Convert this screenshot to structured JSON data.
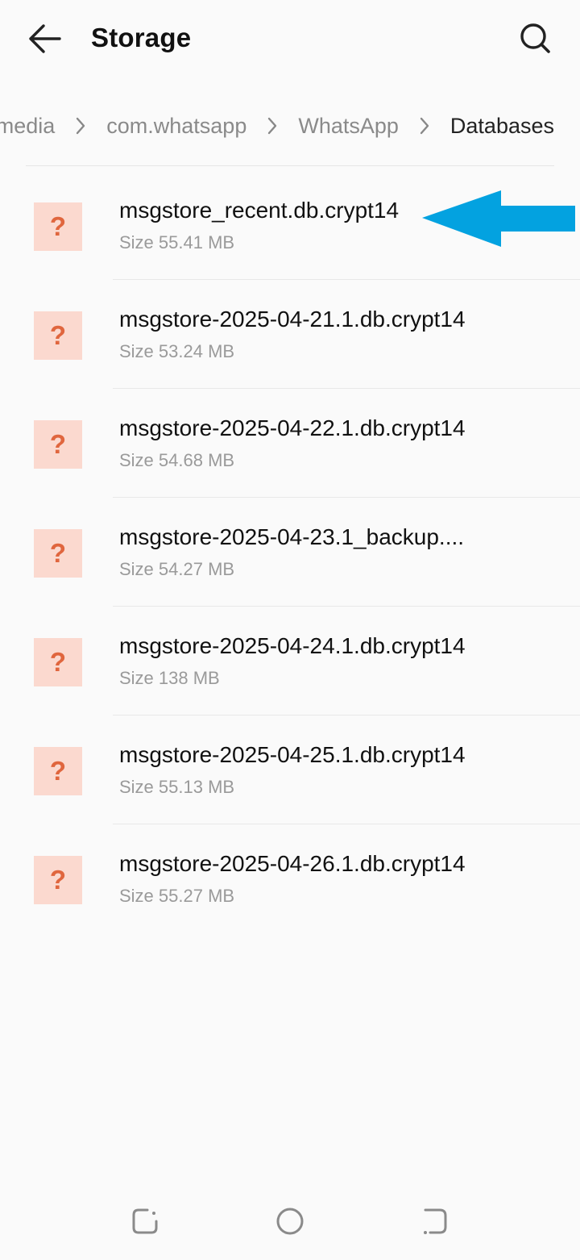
{
  "header": {
    "title": "Storage",
    "back_icon": "arrow-left-icon",
    "search_icon": "search-icon"
  },
  "breadcrumb": {
    "items": [
      "media",
      "com.whatsapp",
      "WhatsApp",
      "Databases"
    ],
    "separator_icon": "chevron-right-icon"
  },
  "files": [
    {
      "name": "msgstore_recent.db.crypt14",
      "size": "Size 55.41 MB",
      "icon": "unknown-file-icon"
    },
    {
      "name": "msgstore-2025-04-21.1.db.crypt14",
      "size": "Size 53.24 MB",
      "icon": "unknown-file-icon"
    },
    {
      "name": "msgstore-2025-04-22.1.db.crypt14",
      "size": "Size 54.68 MB",
      "icon": "unknown-file-icon"
    },
    {
      "name": "msgstore-2025-04-23.1_backup....",
      "size": "Size 54.27 MB",
      "icon": "unknown-file-icon"
    },
    {
      "name": "msgstore-2025-04-24.1.db.crypt14",
      "size": "Size 138 MB",
      "icon": "unknown-file-icon"
    },
    {
      "name": "msgstore-2025-04-25.1.db.crypt14",
      "size": "Size 55.13 MB",
      "icon": "unknown-file-icon"
    },
    {
      "name": "msgstore-2025-04-26.1.db.crypt14",
      "size": "Size 55.27 MB",
      "icon": "unknown-file-icon"
    }
  ],
  "file_icon_glyph": "?",
  "annotation": {
    "icon": "blue-arrow-icon",
    "color": "#03a2e0",
    "points_to": "msgstore_recent.db.crypt14"
  },
  "navbar": {
    "icons": [
      "recents-icon",
      "home-icon",
      "back-gesture-icon"
    ]
  },
  "colors": {
    "icon_bg": "#fbd9cf",
    "icon_fg": "#e0663e",
    "background": "#fafafa"
  }
}
